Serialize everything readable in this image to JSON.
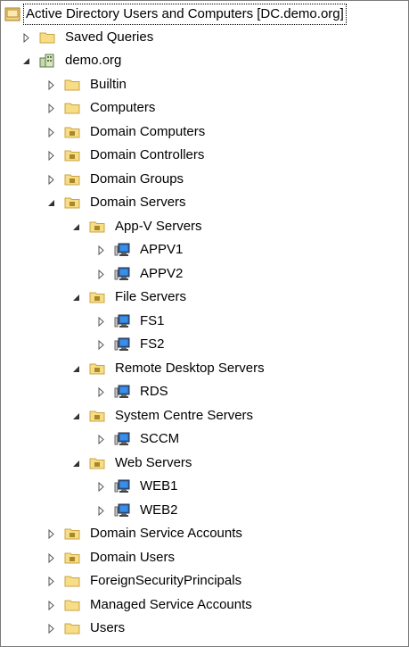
{
  "tree": {
    "root": "Active Directory Users and Computers [DC.demo.org]",
    "saved_queries": "Saved Queries",
    "domain": "demo.org",
    "builtin": "Builtin",
    "computers": "Computers",
    "domain_computers": "Domain Computers",
    "domain_controllers": "Domain Controllers",
    "domain_groups": "Domain Groups",
    "domain_servers": "Domain Servers",
    "appv_servers": "App-V Servers",
    "appv1": "APPV1",
    "appv2": "APPV2",
    "file_servers": "File Servers",
    "fs1": "FS1",
    "fs2": "FS2",
    "rds_servers": "Remote Desktop Servers",
    "rds": "RDS",
    "sc_servers": "System Centre Servers",
    "sccm": "SCCM",
    "web_servers": "Web Servers",
    "web1": "WEB1",
    "web2": "WEB2",
    "domain_service_accounts": "Domain Service Accounts",
    "domain_users": "Domain Users",
    "fsp": "ForeignSecurityPrincipals",
    "msa": "Managed Service Accounts",
    "users": "Users"
  }
}
